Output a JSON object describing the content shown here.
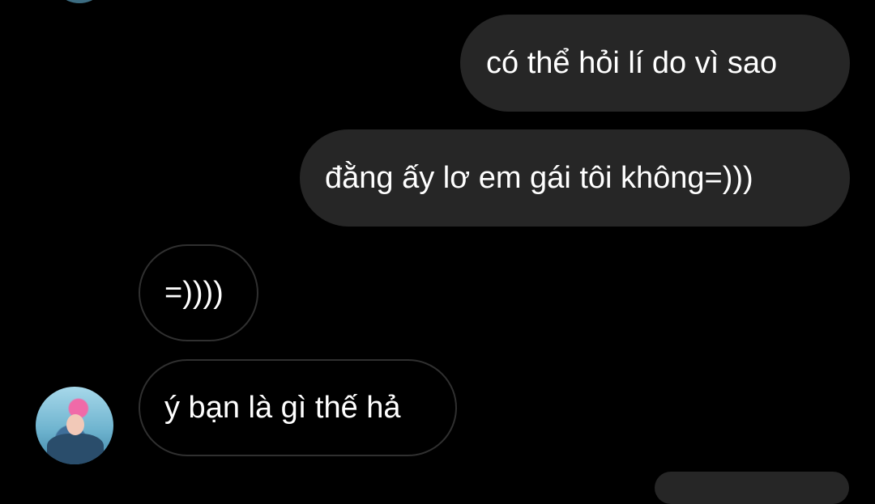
{
  "conversation": {
    "messages": [
      {
        "direction": "sent",
        "text": "có thể hỏi lí do vì sao"
      },
      {
        "direction": "sent",
        "text": "đằng ấy lơ em gái tôi không=)))"
      },
      {
        "direction": "received",
        "text": "=))))"
      },
      {
        "direction": "received",
        "text": "ý bạn là gì thế hả"
      }
    ]
  },
  "colors": {
    "background": "#000000",
    "sent_bubble": "#262626",
    "received_bubble_border": "#303030",
    "text": "#ffffff"
  },
  "icons": {
    "contact_avatar": "contact-avatar",
    "previous_avatar": "contact-avatar-partial"
  }
}
